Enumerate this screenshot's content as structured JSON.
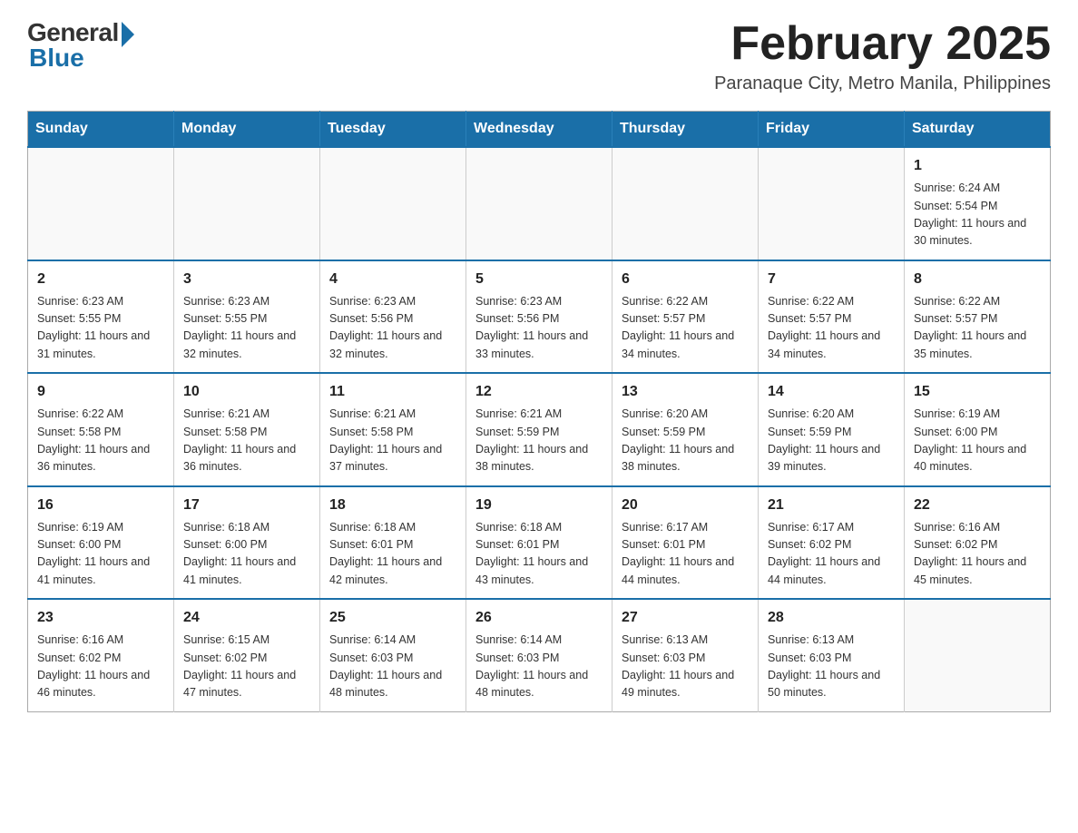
{
  "header": {
    "logo_general": "General",
    "logo_blue": "Blue",
    "title": "February 2025",
    "location": "Paranaque City, Metro Manila, Philippines"
  },
  "weekdays": [
    "Sunday",
    "Monday",
    "Tuesday",
    "Wednesday",
    "Thursday",
    "Friday",
    "Saturday"
  ],
  "weeks": [
    [
      {
        "day": "",
        "info": ""
      },
      {
        "day": "",
        "info": ""
      },
      {
        "day": "",
        "info": ""
      },
      {
        "day": "",
        "info": ""
      },
      {
        "day": "",
        "info": ""
      },
      {
        "day": "",
        "info": ""
      },
      {
        "day": "1",
        "info": "Sunrise: 6:24 AM\nSunset: 5:54 PM\nDaylight: 11 hours\nand 30 minutes."
      }
    ],
    [
      {
        "day": "2",
        "info": "Sunrise: 6:23 AM\nSunset: 5:55 PM\nDaylight: 11 hours\nand 31 minutes."
      },
      {
        "day": "3",
        "info": "Sunrise: 6:23 AM\nSunset: 5:55 PM\nDaylight: 11 hours\nand 32 minutes."
      },
      {
        "day": "4",
        "info": "Sunrise: 6:23 AM\nSunset: 5:56 PM\nDaylight: 11 hours\nand 32 minutes."
      },
      {
        "day": "5",
        "info": "Sunrise: 6:23 AM\nSunset: 5:56 PM\nDaylight: 11 hours\nand 33 minutes."
      },
      {
        "day": "6",
        "info": "Sunrise: 6:22 AM\nSunset: 5:57 PM\nDaylight: 11 hours\nand 34 minutes."
      },
      {
        "day": "7",
        "info": "Sunrise: 6:22 AM\nSunset: 5:57 PM\nDaylight: 11 hours\nand 34 minutes."
      },
      {
        "day": "8",
        "info": "Sunrise: 6:22 AM\nSunset: 5:57 PM\nDaylight: 11 hours\nand 35 minutes."
      }
    ],
    [
      {
        "day": "9",
        "info": "Sunrise: 6:22 AM\nSunset: 5:58 PM\nDaylight: 11 hours\nand 36 minutes."
      },
      {
        "day": "10",
        "info": "Sunrise: 6:21 AM\nSunset: 5:58 PM\nDaylight: 11 hours\nand 36 minutes."
      },
      {
        "day": "11",
        "info": "Sunrise: 6:21 AM\nSunset: 5:58 PM\nDaylight: 11 hours\nand 37 minutes."
      },
      {
        "day": "12",
        "info": "Sunrise: 6:21 AM\nSunset: 5:59 PM\nDaylight: 11 hours\nand 38 minutes."
      },
      {
        "day": "13",
        "info": "Sunrise: 6:20 AM\nSunset: 5:59 PM\nDaylight: 11 hours\nand 38 minutes."
      },
      {
        "day": "14",
        "info": "Sunrise: 6:20 AM\nSunset: 5:59 PM\nDaylight: 11 hours\nand 39 minutes."
      },
      {
        "day": "15",
        "info": "Sunrise: 6:19 AM\nSunset: 6:00 PM\nDaylight: 11 hours\nand 40 minutes."
      }
    ],
    [
      {
        "day": "16",
        "info": "Sunrise: 6:19 AM\nSunset: 6:00 PM\nDaylight: 11 hours\nand 41 minutes."
      },
      {
        "day": "17",
        "info": "Sunrise: 6:18 AM\nSunset: 6:00 PM\nDaylight: 11 hours\nand 41 minutes."
      },
      {
        "day": "18",
        "info": "Sunrise: 6:18 AM\nSunset: 6:01 PM\nDaylight: 11 hours\nand 42 minutes."
      },
      {
        "day": "19",
        "info": "Sunrise: 6:18 AM\nSunset: 6:01 PM\nDaylight: 11 hours\nand 43 minutes."
      },
      {
        "day": "20",
        "info": "Sunrise: 6:17 AM\nSunset: 6:01 PM\nDaylight: 11 hours\nand 44 minutes."
      },
      {
        "day": "21",
        "info": "Sunrise: 6:17 AM\nSunset: 6:02 PM\nDaylight: 11 hours\nand 44 minutes."
      },
      {
        "day": "22",
        "info": "Sunrise: 6:16 AM\nSunset: 6:02 PM\nDaylight: 11 hours\nand 45 minutes."
      }
    ],
    [
      {
        "day": "23",
        "info": "Sunrise: 6:16 AM\nSunset: 6:02 PM\nDaylight: 11 hours\nand 46 minutes."
      },
      {
        "day": "24",
        "info": "Sunrise: 6:15 AM\nSunset: 6:02 PM\nDaylight: 11 hours\nand 47 minutes."
      },
      {
        "day": "25",
        "info": "Sunrise: 6:14 AM\nSunset: 6:03 PM\nDaylight: 11 hours\nand 48 minutes."
      },
      {
        "day": "26",
        "info": "Sunrise: 6:14 AM\nSunset: 6:03 PM\nDaylight: 11 hours\nand 48 minutes."
      },
      {
        "day": "27",
        "info": "Sunrise: 6:13 AM\nSunset: 6:03 PM\nDaylight: 11 hours\nand 49 minutes."
      },
      {
        "day": "28",
        "info": "Sunrise: 6:13 AM\nSunset: 6:03 PM\nDaylight: 11 hours\nand 50 minutes."
      },
      {
        "day": "",
        "info": ""
      }
    ]
  ]
}
